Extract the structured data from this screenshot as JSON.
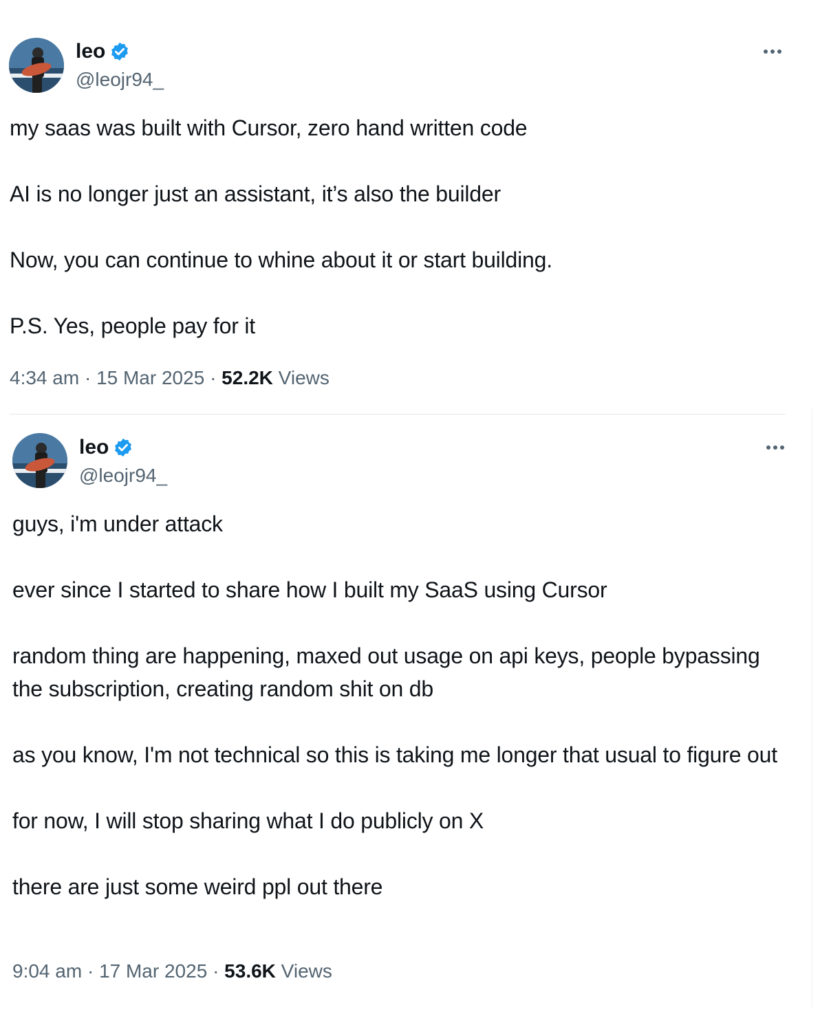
{
  "tweets": [
    {
      "author": {
        "name": "leo",
        "handle": "@leojr94_",
        "verified": true
      },
      "paragraphs": [
        "my saas was built with Cursor, zero hand written code",
        "AI is no longer just an assistant, it’s also the builder",
        "Now, you can continue to whine about it or start building.",
        "P.S. Yes, people pay for it"
      ],
      "time": "4:34 am",
      "date": "15 Mar 2025",
      "views_count": "52.2K",
      "views_label": "Views"
    },
    {
      "author": {
        "name": "leo",
        "handle": "@leojr94_",
        "verified": true
      },
      "paragraphs": [
        "guys, i'm under attack",
        "ever since I started to share how I built my SaaS using Cursor",
        "random thing are happening, maxed out usage on api keys, people bypassing the subscription, creating random shit on db",
        "as you know, I'm not technical so this is taking me longer that usual to figure out",
        "for now, I will stop sharing what I do publicly on X",
        "there are just some weird ppl out there"
      ],
      "time": "9:04 am",
      "date": "17 Mar 2025",
      "views_count": "53.6K",
      "views_label": "Views"
    }
  ],
  "colors": {
    "text": "#0f1419",
    "secondary": "#536471",
    "verified_badge": "#1d9bf0"
  },
  "icons": {
    "verified": "verified-badge-icon",
    "more": "more-options-icon"
  }
}
